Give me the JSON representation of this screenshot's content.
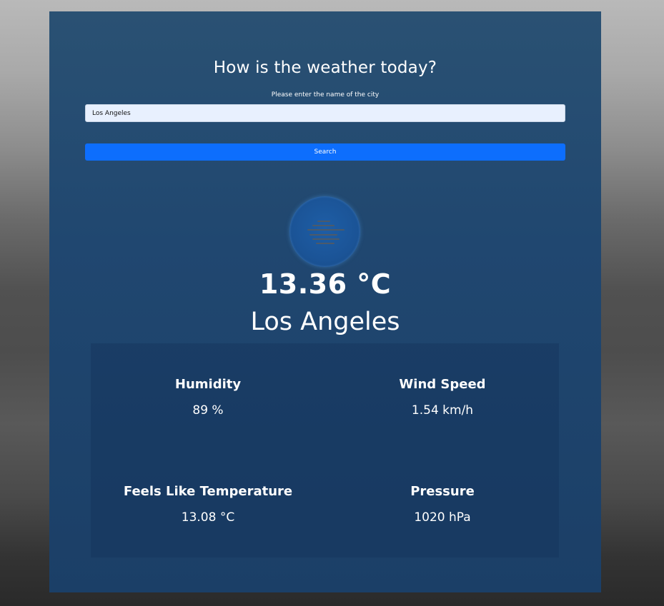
{
  "header": {
    "title": "How is the weather today?"
  },
  "search": {
    "prompt": "Please enter the name of the city",
    "value": "Los Angeles",
    "button_label": "Search"
  },
  "current": {
    "icon": "fog-icon",
    "temperature": "13.36 °C",
    "city": "Los Angeles"
  },
  "details": {
    "humidity_label": "Humidity",
    "humidity_value": "89 %",
    "wind_label": "Wind Speed",
    "wind_value": "1.54 km/h",
    "feels_label": "Feels Like Temperature",
    "feels_value": "13.08 °C",
    "pressure_label": "Pressure",
    "pressure_value": "1020 hPa"
  },
  "colors": {
    "card_background": "#204770",
    "search_button": "#0d6efd",
    "input_background": "#e8f0fe",
    "text": "#ffffff"
  }
}
